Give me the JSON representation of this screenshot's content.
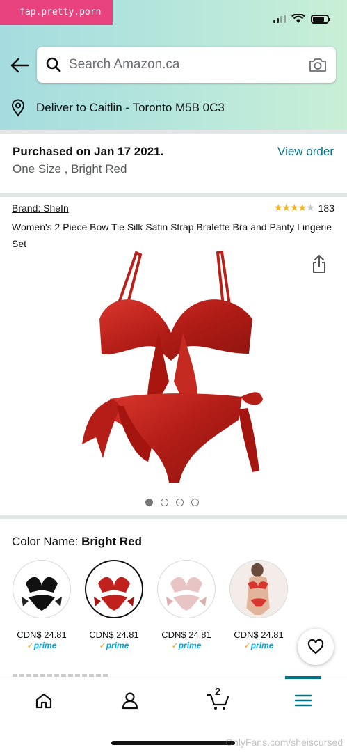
{
  "watermark": "fap.pretty.porn",
  "search": {
    "placeholder": "Search Amazon.ca"
  },
  "deliver": {
    "text": "Deliver to Caitlin - Toronto M5B 0C3"
  },
  "order": {
    "purchased": "Purchased on Jan 17 2021.",
    "variant": "One Size , Bright Red",
    "view_order": "View order"
  },
  "product": {
    "brand": "Brand: SheIn",
    "rating_count": "183",
    "rating_stars": 4,
    "title": "Women's 2 Piece Bow Tie Silk Satin Strap Bralette Bra and Panty Lingerie Set",
    "image_count": 4,
    "active_image": 1
  },
  "color": {
    "label": "Color Name:",
    "selected": "Bright Red",
    "swatches": [
      {
        "price": "CDN$ 24.81",
        "prime": "prime",
        "color": "#111111"
      },
      {
        "price": "CDN$ 24.81",
        "prime": "prime",
        "color": "#c0211c"
      },
      {
        "price": "CDN$ 24.81",
        "prime": "prime",
        "color": "#e8c4c4"
      },
      {
        "price": "CDN$ 24.81",
        "prime": "prime",
        "color": "#d8352e"
      }
    ]
  },
  "nav": {
    "cart_count": "2"
  },
  "footer_watermark": "OnlyFans.com/sheiscursed",
  "colors": {
    "accent": "#007185",
    "star": "#f0b41f",
    "product_red": "#c0211c",
    "prime_blue": "#00a8e1"
  },
  "icons": [
    "back-arrow-icon",
    "search-icon",
    "camera-icon",
    "location-pin-icon",
    "share-icon",
    "heart-icon",
    "home-icon",
    "account-icon",
    "cart-icon",
    "menu-icon"
  ]
}
